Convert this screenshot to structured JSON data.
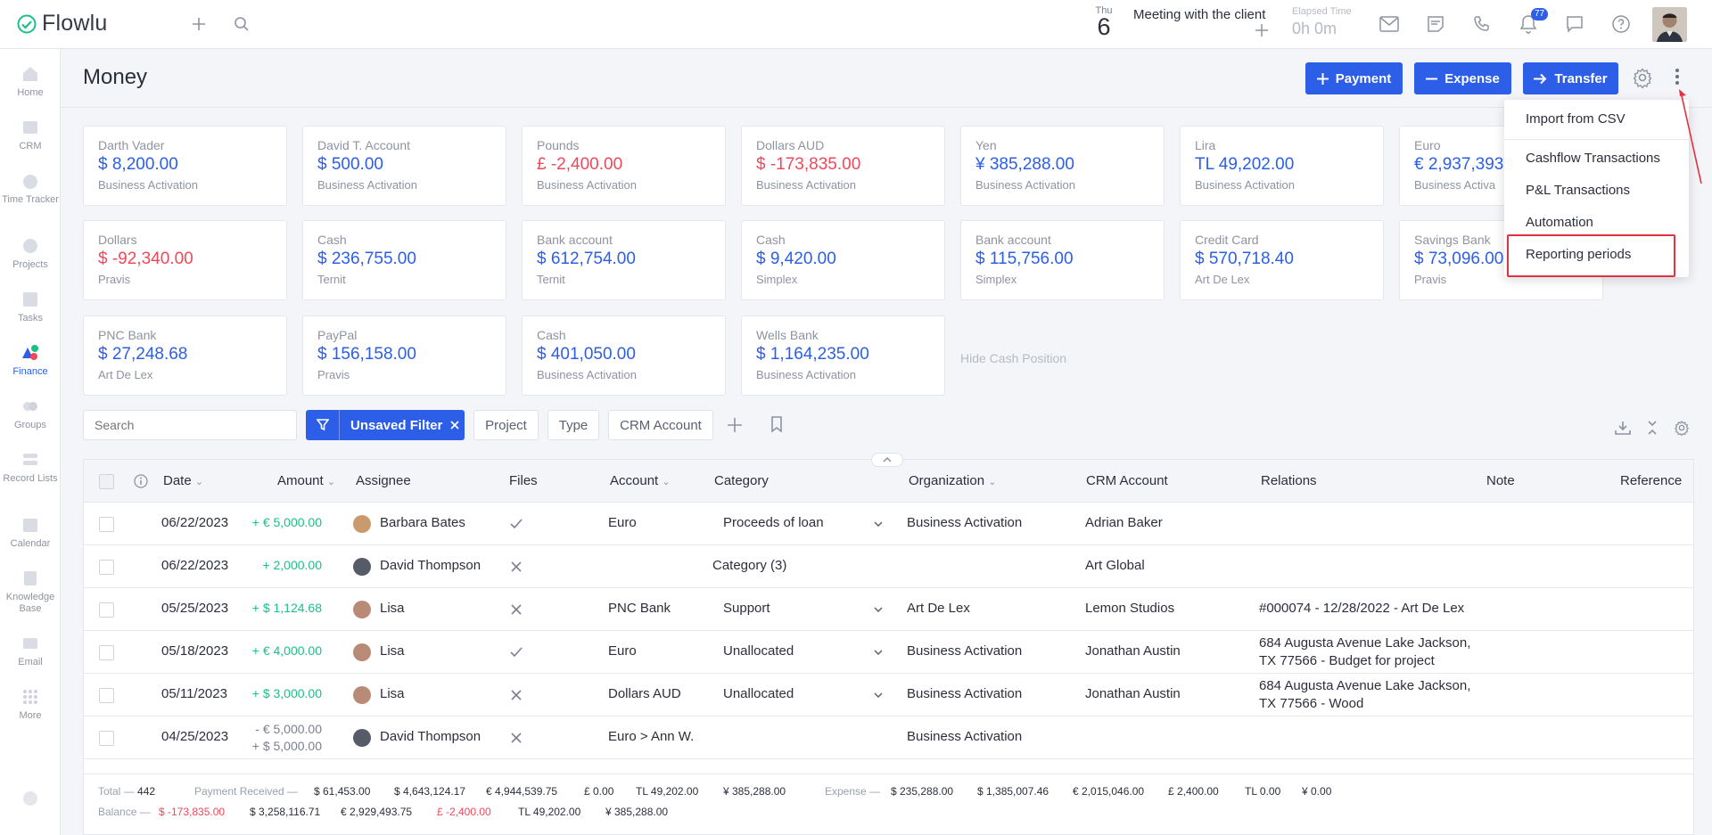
{
  "app": {
    "name": "Flowlu"
  },
  "topbar": {
    "calendar": {
      "weekday": "Thu",
      "day": "6"
    },
    "meeting": "Meeting with the client",
    "elapsed": {
      "label": "Elapsed Time",
      "value": "0h 0m"
    },
    "notifications_count": "77",
    "icons": [
      "plus-icon",
      "search-icon",
      "mail-icon",
      "notes-icon",
      "phone-icon",
      "bell-icon",
      "chat-icon",
      "help-icon"
    ]
  },
  "sidebar": {
    "items": [
      {
        "label": "Home",
        "icon": "home-icon"
      },
      {
        "label": "CRM",
        "icon": "crm-icon"
      },
      {
        "label": "Time Tracker",
        "icon": "timer-icon"
      },
      {
        "label": "Projects",
        "icon": "projects-icon"
      },
      {
        "label": "Tasks",
        "icon": "tasks-icon"
      },
      {
        "label": "Finance",
        "icon": "finance-icon"
      },
      {
        "label": "Groups",
        "icon": "groups-icon"
      },
      {
        "label": "Record Lists",
        "icon": "record-lists-icon"
      },
      {
        "label": "Calendar",
        "icon": "calendar-icon"
      },
      {
        "label": "Knowledge Base",
        "icon": "knowledge-base-icon"
      },
      {
        "label": "Email",
        "icon": "email-icon"
      },
      {
        "label": "More",
        "icon": "more-icon"
      }
    ]
  },
  "page": {
    "title": "Money"
  },
  "actions": {
    "payment": "Payment",
    "expense": "Expense",
    "transfer": "Transfer"
  },
  "accounts": [
    {
      "name": "Darth Vader",
      "amount": "$ 8,200.00",
      "org": "Business Activation",
      "negative": false
    },
    {
      "name": "David T. Account",
      "amount": "$ 500.00",
      "org": "Business Activation",
      "negative": false
    },
    {
      "name": "Pounds",
      "amount": "£ -2,400.00",
      "org": "Business Activation",
      "negative": true
    },
    {
      "name": "Dollars AUD",
      "amount": "$ -173,835.00",
      "org": "Business Activation",
      "negative": true
    },
    {
      "name": "Yen",
      "amount": "¥ 385,288.00",
      "org": "Business Activation",
      "negative": false
    },
    {
      "name": "Lira",
      "amount": "TL 49,202.00",
      "org": "Business Activation",
      "negative": false
    },
    {
      "name": "Euro",
      "amount": "€ 2,937,393",
      "org": "Business Activa",
      "negative": false
    },
    {
      "name": "Dollars",
      "amount": "$ -92,340.00",
      "org": "Pravis",
      "negative": true
    },
    {
      "name": "Cash",
      "amount": "$ 236,755.00",
      "org": "Ternit",
      "negative": false
    },
    {
      "name": "Bank account",
      "amount": "$ 612,754.00",
      "org": "Ternit",
      "negative": false
    },
    {
      "name": "Cash",
      "amount": "$ 9,420.00",
      "org": "Simplex",
      "negative": false
    },
    {
      "name": "Bank account",
      "amount": "$ 115,756.00",
      "org": "Simplex",
      "negative": false
    },
    {
      "name": "Credit Card",
      "amount": "$ 570,718.40",
      "org": "Art De Lex",
      "negative": false
    },
    {
      "name": "Savings Bank",
      "amount": "$ 73,096.00",
      "org": "Pravis",
      "negative": false
    },
    {
      "name": "PNC Bank",
      "amount": "$ 27,248.68",
      "org": "Art De Lex",
      "negative": false
    },
    {
      "name": "PayPal",
      "amount": "$ 156,158.00",
      "org": "Pravis",
      "negative": false
    },
    {
      "name": "Cash",
      "amount": "$ 401,050.00",
      "org": "Business Activation",
      "negative": false
    },
    {
      "name": "Wells Bank",
      "amount": "$ 1,164,235.00",
      "org": "Business Activation",
      "negative": false
    }
  ],
  "hide_cash": "Hide Cash Position",
  "filters": {
    "search_placeholder": "Search",
    "unsaved": "Unsaved Filter",
    "project": "Project",
    "type": "Type",
    "crm_account": "CRM Account"
  },
  "table": {
    "columns": [
      "Date",
      "Amount",
      "Assignee",
      "Files",
      "Account",
      "Category",
      "Organization",
      "CRM Account",
      "Relations",
      "Note",
      "Reference"
    ],
    "rows": [
      {
        "date": "06/22/2023",
        "amount": "+ € 5,000.00",
        "amount2": "",
        "amount_type": "pos",
        "assignee": "Barbara Bates",
        "file": "check",
        "account": "Euro",
        "category": "Proceeds of loan",
        "cat_dropdown": true,
        "org": "Business Activation",
        "crm": "Adrian Baker",
        "rel1": "",
        "rel2": ""
      },
      {
        "date": "06/22/2023",
        "amount": "+ 2,000.00",
        "amount2": "",
        "amount_type": "pos",
        "assignee": "David Thompson",
        "file": "x",
        "account": "",
        "category": "Category (3)",
        "cat_dropdown": false,
        "org": "",
        "crm": "Art Global",
        "rel1": "",
        "rel2": ""
      },
      {
        "date": "05/25/2023",
        "amount": "+ $ 1,124.68",
        "amount2": "",
        "amount_type": "pos",
        "assignee": "Lisa",
        "file": "x",
        "account": "PNC Bank",
        "category": "Support",
        "cat_dropdown": true,
        "org": "Art De Lex",
        "crm": "Lemon Studios",
        "rel1": "#000074 - 12/28/2022 - Art De Lex",
        "rel2": ""
      },
      {
        "date": "05/18/2023",
        "amount": "+ € 4,000.00",
        "amount2": "",
        "amount_type": "pos",
        "assignee": "Lisa",
        "file": "check",
        "account": "Euro",
        "category": "Unallocated",
        "cat_dropdown": true,
        "org": "Business Activation",
        "crm": "Jonathan Austin",
        "rel1": "684 Augusta Avenue Lake Jackson,",
        "rel2": "TX 77566 - Budget for project"
      },
      {
        "date": "05/11/2023",
        "amount": "+ $ 3,000.00",
        "amount2": "",
        "amount_type": "pos",
        "assignee": "Lisa",
        "file": "x",
        "account": "Dollars AUD",
        "category": "Unallocated",
        "cat_dropdown": true,
        "org": "Business Activation",
        "crm": "Jonathan Austin",
        "rel1": "684 Augusta Avenue Lake Jackson,",
        "rel2": "TX 77566 - Wood"
      },
      {
        "date": "04/25/2023",
        "amount": "- € 5,000.00",
        "amount2": "+ $ 5,000.00",
        "amount_type": "mut",
        "assignee": "David Thompson",
        "file": "x",
        "account": "Euro > Ann W.",
        "category": "",
        "cat_dropdown": false,
        "org": "Business Activation",
        "crm": "",
        "rel1": "",
        "rel2": ""
      }
    ]
  },
  "totals": {
    "total_label": "Total —",
    "total": "442",
    "payment_label": "Payment Received —",
    "payment": [
      "$ 61,453.00",
      "$ 4,643,124.17",
      "€ 4,944,539.75",
      "£ 0.00",
      "TL 49,202.00",
      "¥ 385,288.00"
    ],
    "expense_label": "Expense —",
    "expense": [
      "$ 235,288.00",
      "$ 1,385,007.46",
      "€ 2,015,046.00",
      "£ 2,400.00",
      "TL 0.00",
      "¥ 0.00"
    ],
    "balance_label": "Balance —",
    "balance": [
      "$ -173,835.00",
      "$ 3,258,116.71",
      "€ 2,929,493.75",
      "£ -2,400.00",
      "TL 49,202.00",
      "¥ 385,288.00"
    ]
  },
  "menu": {
    "items": [
      "Import from CSV",
      "Cashflow Transactions",
      "P&L Transactions",
      "Automation",
      "Reporting periods"
    ]
  },
  "colors": {
    "accent": "#2c5ee8",
    "positive": "#1bbf8a",
    "negative": "#f0485a",
    "highlight": "#e0323f"
  }
}
